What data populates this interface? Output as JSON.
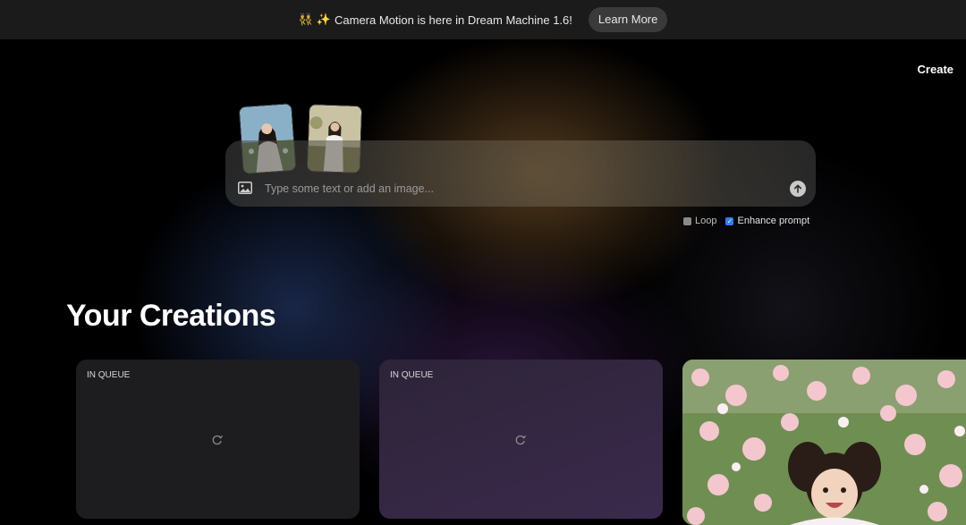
{
  "banner": {
    "emoji_1": "👯",
    "emoji_2": "✨",
    "text": "Camera Motion is here in Dream Machine 1.6!",
    "button_label": "Learn More"
  },
  "nav": {
    "create_label": "Create"
  },
  "prompt": {
    "placeholder": "Type some text or add an image...",
    "value": "",
    "options": [
      {
        "label": "Loop",
        "checked": false
      },
      {
        "label": "Enhance prompt",
        "checked": true
      }
    ]
  },
  "creations": {
    "title": "Your Creations",
    "cards": [
      {
        "status": "IN QUEUE"
      },
      {
        "status": "IN QUEUE"
      }
    ]
  },
  "colors": {
    "accent": "#2f7df6",
    "banner_bg": "#1b1b1c"
  }
}
